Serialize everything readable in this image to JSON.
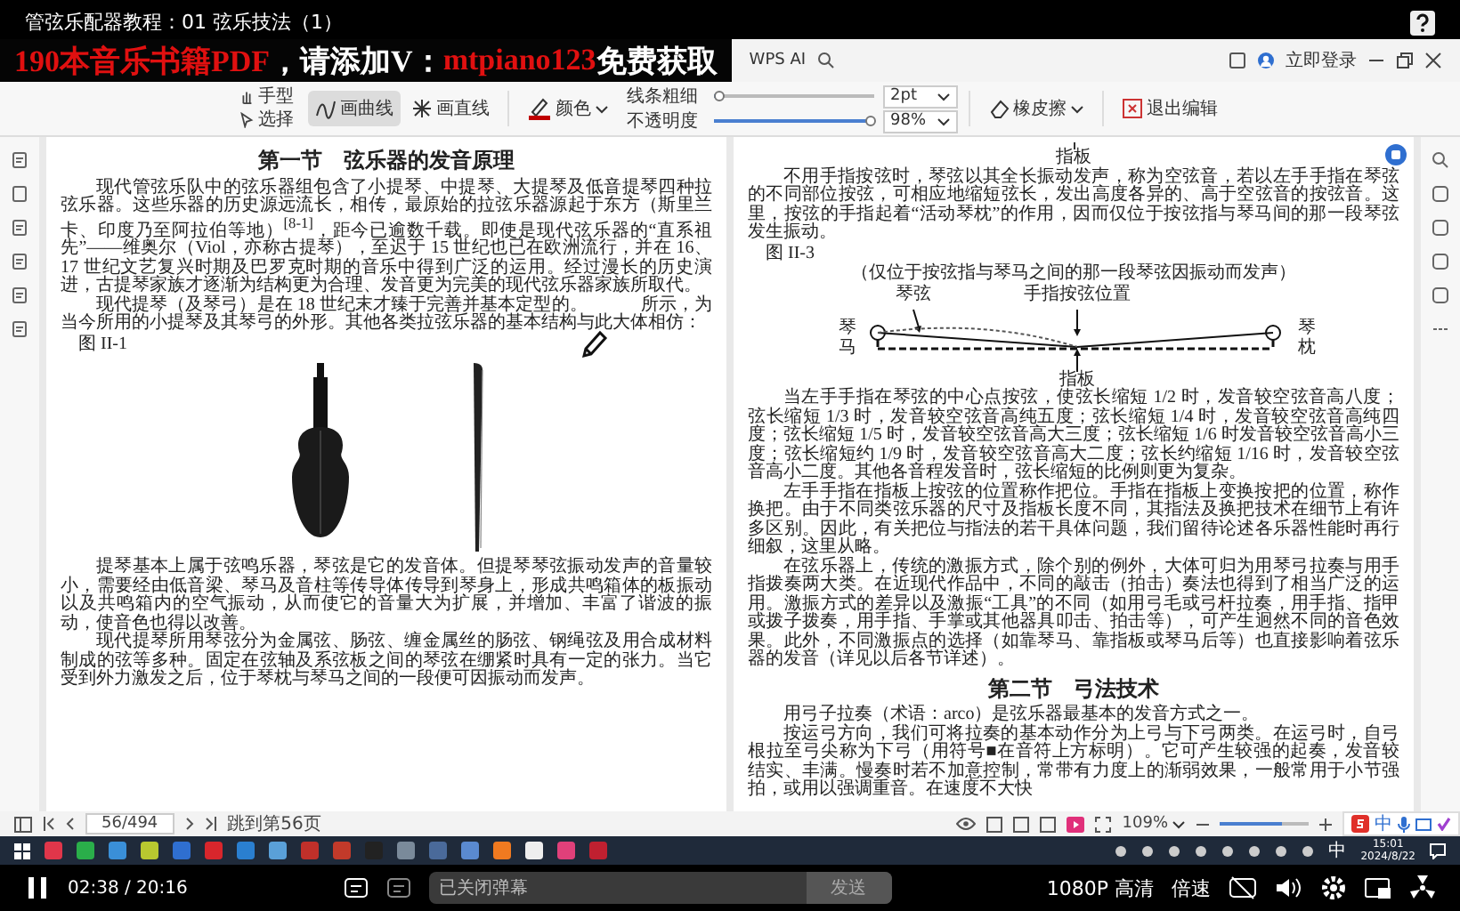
{
  "video": {
    "title": "管弦乐配器教程：01 弦乐技法（1）",
    "playing": true,
    "time": "02:38 / 20:16",
    "danmaku_placeholder": "已关闭弹幕",
    "send": "发送",
    "quality": "1080P 高清",
    "speed": "倍速"
  },
  "banner": [
    {
      "text": "190本音乐书籍PDF",
      "color": "#e01010"
    },
    {
      "text": "，请添加V：",
      "color": "#ffffff"
    },
    {
      "text": "mtpiano123",
      "color": "#e01010"
    },
    {
      "text": "免费获取",
      "color": "#ffffff"
    }
  ],
  "app": {
    "login": "立即登录",
    "ai": "WPS AI"
  },
  "toolbar": {
    "tools": [
      {
        "label": "手型",
        "kind": "hand",
        "selected": false
      },
      {
        "label": "选择",
        "kind": "select",
        "selected": false
      }
    ],
    "pens": [
      {
        "label": "画曲线",
        "kind": "curve",
        "selected": true
      },
      {
        "label": "画直线",
        "kind": "line",
        "selected": false
      }
    ],
    "color_label": "颜色",
    "thickness": {
      "label": "线条粗细",
      "level": 0.03,
      "value": "2pt"
    },
    "opacity": {
      "label": "不透明度",
      "level": 0.98,
      "value": "98%"
    },
    "eraser": "橡皮擦",
    "exit": "退出编辑"
  },
  "left_page": {
    "blocks": [
      {
        "kind": "heading",
        "text": "第一节　弦乐器的发音原理"
      },
      {
        "kind": "paragraph",
        "text": "现代管弦乐队中的弦乐器组包含了小提琴、中提琴、大提琴及低音提琴四种拉弦乐器。这些乐器的历史源远流长，相传，最原始的拉弦乐器源起于东方（斯里兰卡、印度乃至阿拉伯等地）$^{[8-1]}$，距今已逾数千载。即使是现代弦乐器的“直系祖先”——维奥尔（Viol，亦称古提琴），至迟于 15 世纪也已在欧洲流行，并在 16、17 世纪文艺复兴时期及巴罗克时期的音乐中得到广泛的运用。经过漫长的历史演进，古提琴家族才逐渐为结构更为合理、发音更为完美的现代弦乐器家族所取代。"
      },
      {
        "kind": "paragraph",
        "text": "现代提琴（及琴弓）是在 18 世纪末才臻于完善并基本定型的。　　　所示，为当今所用的小提琴及其琴弓的外形。其他各类拉弦乐器的基本结构与此大体相仿："
      },
      {
        "kind": "figure_label",
        "cursor": true,
        "text": "图 II-1"
      },
      {
        "kind": "violin_figure"
      },
      {
        "kind": "paragraph",
        "text": "提琴基本上属于弦鸣乐器，琴弦是它的发音体。但提琴琴弦振动发声的音量较小，需要经由低音梁、琴马及音柱等传导体传导到琴身上，形成共鸣箱体的板振动以及共鸣箱内的空气振动，从而使它的音量大为扩展，并增加、丰富了谐波的振动，使音色也得以改善。"
      },
      {
        "kind": "paragraph",
        "text": "现代提琴所用琴弦分为金属弦、肠弦、缠金属丝的肠弦、钢绳弦及用合成材料制成的弦等多种。固定在弦轴及系弦板之间的琴弦在绷紧时具有一定的张力。当它受到外力激发之后，位于琴枕与琴马之间的一段便可因振动而发声。"
      }
    ]
  },
  "right_page": {
    "blocks": [
      {
        "kind": "label",
        "text": "指板"
      },
      {
        "kind": "paragraph",
        "text": "不用手指按弦时，琴弦以其全长振动发声，称为空弦音，若以左手手指在琴弦的不同部位按弦，可相应地缩短弦长，发出高度各异的、高于空弦音的按弦音。这里，按弦的手指起着“活动琴枕”的作用，因而仅位于按弦指与琴马间的那一段琴弦发生振动。"
      },
      {
        "kind": "figure_label",
        "text": "图 II-3"
      },
      {
        "kind": "string_diagram",
        "caption": "（仅位于按弦指与琴马之间的那一段琴弦因振动而发声）",
        "string": "琴弦",
        "finger": "手指按弦位置",
        "bridge": "琴马",
        "nut": "琴枕",
        "board": "指板"
      },
      {
        "kind": "paragraph",
        "text": "当左手手指在琴弦的中心点按弦，使弦长缩短 1/2 时，发音较空弦音高八度；弦长缩短 1/3 时，发音较空弦音高纯五度；弦长缩短 1/4 时，发音较空弦音高纯四度；弦长缩短 1/5 时，发音较空弦音高大三度；弦长缩短 1/6 时发音较空弦音高小三度；弦长缩短约 1/9 时，发音较空弦音高大二度；弦长约缩短 1/16 时，发音较空弦音高小二度。其他各音程发音时，弦长缩短的比例则更为复杂。"
      },
      {
        "kind": "paragraph",
        "text": "左手手指在指板上按弦的位置称作把位。手指在指板上变换按把的位置，称作换把。由于不同类弦乐器的尺寸及指板长度不同，其指法及换把技术在细节上有许多区别。因此，有关把位与指法的若干具体问题，我们留待论述各乐器性能时再行细叙，这里从略。"
      },
      {
        "kind": "paragraph",
        "text": "在弦乐器上，传统的激振方式，除个别的例外，大体可归为用琴弓拉奏与用手指拨奏两大类。在近现代作品中，不同的敲击（拍击）奏法也得到了相当广泛的运用。激振方式的差异以及激振“工具”的不同（如用弓毛或弓杆拉奏，用手指、指甲或拨子拨奏，用手指、手掌或其他器具叩击、拍击等），可产生迥然不同的音色效果。此外，不同激振点的选择（如靠琴马、靠指板或琴马后等）也直接影响着弦乐器的发音（详见以后各节详述）。"
      },
      {
        "kind": "heading",
        "text": "第二节　弓法技术"
      },
      {
        "kind": "paragraph",
        "text": "用弓子拉奏（术语：arco）是弦乐器最基本的发音方式之一。"
      },
      {
        "kind": "paragraph",
        "text": "按运弓方向，我们可将拉奏的基本动作分为上弓与下弓两类。在运弓时，自弓根拉至弓尖称为下弓（用符号■在音符上方标明）。它可产生较强的起奏，发音较结实、丰满。慢奏时若不加意控制，常带有力度上的渐弱效果，一般常用于小节强拍，或用以强调重音。在速度不大快"
      }
    ]
  },
  "status_bar": {
    "page": "56/494",
    "goto": "跳到第56页",
    "zoom": "109%",
    "zoom_slider": {
      "level": 0.7
    }
  },
  "ime": {
    "label": "中"
  },
  "taskbar": {
    "ime": "中",
    "time": "15:01",
    "date": "2024/8/22"
  }
}
